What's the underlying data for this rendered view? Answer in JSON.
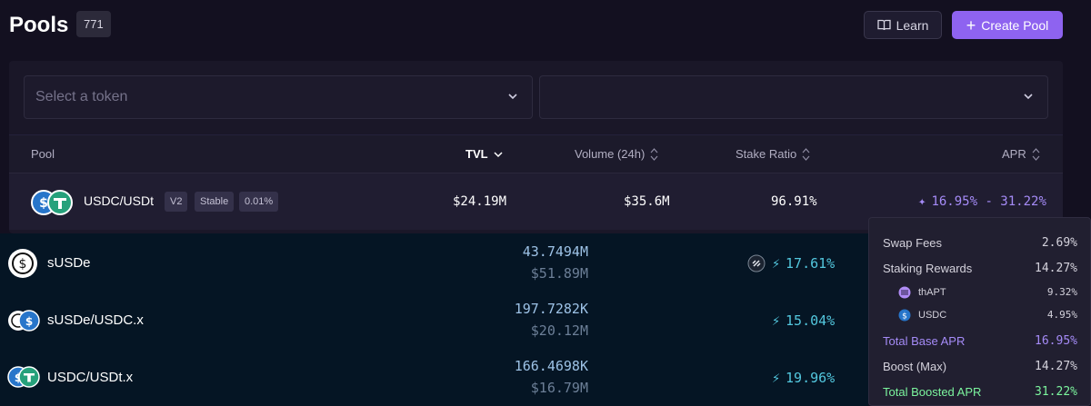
{
  "header": {
    "title": "Pools",
    "count": "771",
    "learn_label": "Learn",
    "create_label": "Create Pool"
  },
  "filters": {
    "token_placeholder": "Select a token",
    "second_value": ""
  },
  "table": {
    "columns": {
      "pool": "Pool",
      "tvl": "TVL",
      "volume": "Volume (24h)",
      "stake_ratio": "Stake Ratio",
      "apr": "APR"
    },
    "rows": [
      {
        "name": "USDC/USDt",
        "version": "V2",
        "type": "Stable",
        "fee": "0.01%",
        "tvl": "$24.19M",
        "volume": "$35.6M",
        "stake_ratio": "96.91%",
        "apr": "16.95% - 31.22%"
      }
    ]
  },
  "lower_list": [
    {
      "name": "sUSDe",
      "amount": "43.7494M",
      "usd": "$51.89M",
      "apr": "17.61%",
      "has_badge": true
    },
    {
      "name": "sUSDe/USDC.x",
      "amount": "197.7282K",
      "usd": "$20.12M",
      "apr": "15.04%"
    },
    {
      "name": "USDC/USDt.x",
      "amount": "166.4698K",
      "usd": "$16.79M",
      "apr": "19.96%"
    }
  ],
  "apr_tooltip": {
    "swap_fees_label": "Swap Fees",
    "swap_fees": "2.69%",
    "staking_label": "Staking Rewards",
    "staking": "14.27%",
    "sub": [
      {
        "name": "thAPT",
        "value": "9.32%"
      },
      {
        "name": "USDC",
        "value": "4.95%"
      }
    ],
    "base_label": "Total Base APR",
    "base": "16.95%",
    "boost_label": "Boost (Max)",
    "boost": "14.27%",
    "boosted_label": "Total Boosted APR",
    "boosted": "31.22%"
  },
  "colors": {
    "accent": "#8e63f0",
    "apr_purple": "#a58bf7",
    "apr_cyan": "#53c7de",
    "boosted_green": "#7cf59e"
  }
}
